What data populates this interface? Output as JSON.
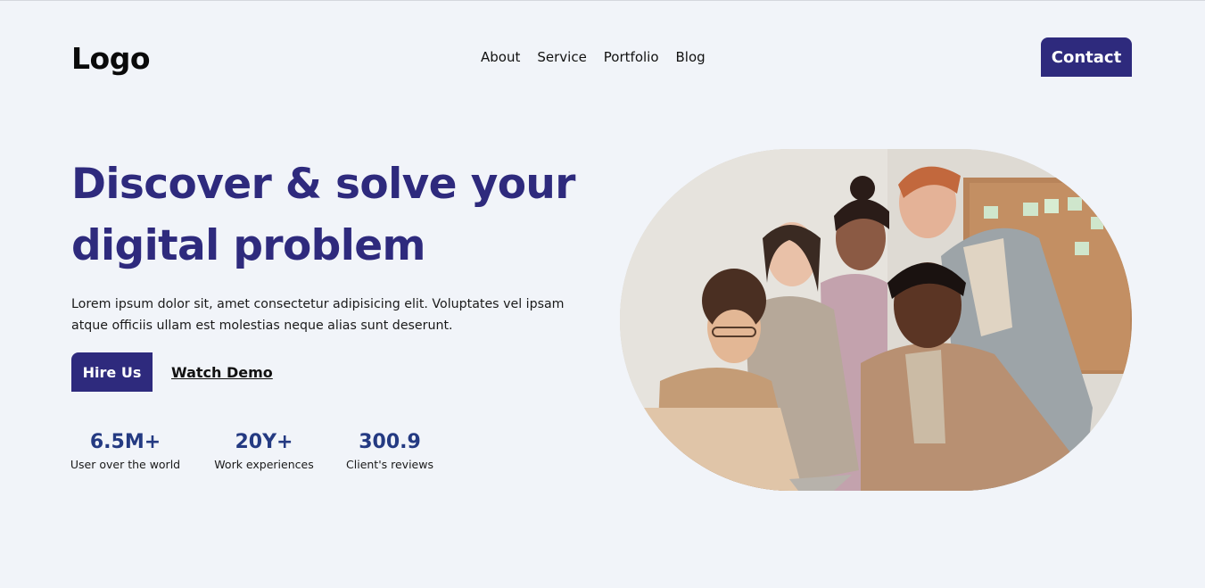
{
  "header": {
    "logo": "Logo",
    "nav": [
      "About",
      "Service",
      "Portfolio",
      "Blog"
    ],
    "contact_label": "Contact"
  },
  "hero": {
    "title_line1": "Discover & solve your",
    "title_line2": "digital problem",
    "description": "Lorem ipsum dolor sit, amet consectetur adipisicing elit. Voluptates vel ipsam atque officiis ullam est molestias neque alias sunt deserunt.",
    "hire_label": "Hire Us",
    "demo_label": "Watch Demo"
  },
  "stats": [
    {
      "value": "6.5M+",
      "label": "User over the world"
    },
    {
      "value": "20Y+",
      "label": "Work experiences"
    },
    {
      "value": "300.9",
      "label": "Client's reviews"
    }
  ],
  "image": {
    "alt": "team-photo"
  },
  "colors": {
    "primary": "#2e2a7d",
    "stat": "#243a82",
    "background": "#f1f4f9"
  }
}
